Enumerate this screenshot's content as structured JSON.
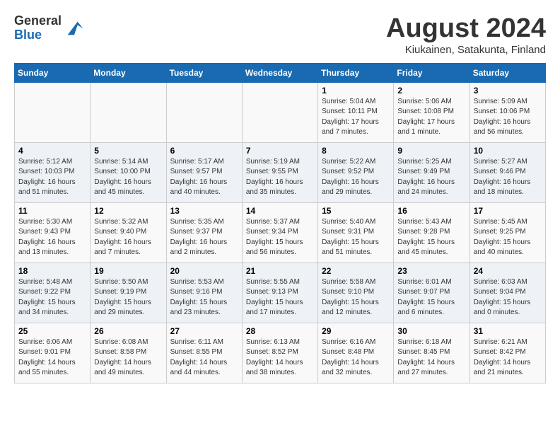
{
  "header": {
    "logo_general": "General",
    "logo_blue": "Blue",
    "month_title": "August 2024",
    "subtitle": "Kiukainen, Satakunta, Finland"
  },
  "days_of_week": [
    "Sunday",
    "Monday",
    "Tuesday",
    "Wednesday",
    "Thursday",
    "Friday",
    "Saturday"
  ],
  "weeks": [
    [
      {
        "day": "",
        "info": ""
      },
      {
        "day": "",
        "info": ""
      },
      {
        "day": "",
        "info": ""
      },
      {
        "day": "",
        "info": ""
      },
      {
        "day": "1",
        "info": "Sunrise: 5:04 AM\nSunset: 10:11 PM\nDaylight: 17 hours\nand 7 minutes."
      },
      {
        "day": "2",
        "info": "Sunrise: 5:06 AM\nSunset: 10:08 PM\nDaylight: 17 hours\nand 1 minute."
      },
      {
        "day": "3",
        "info": "Sunrise: 5:09 AM\nSunset: 10:06 PM\nDaylight: 16 hours\nand 56 minutes."
      }
    ],
    [
      {
        "day": "4",
        "info": "Sunrise: 5:12 AM\nSunset: 10:03 PM\nDaylight: 16 hours\nand 51 minutes."
      },
      {
        "day": "5",
        "info": "Sunrise: 5:14 AM\nSunset: 10:00 PM\nDaylight: 16 hours\nand 45 minutes."
      },
      {
        "day": "6",
        "info": "Sunrise: 5:17 AM\nSunset: 9:57 PM\nDaylight: 16 hours\nand 40 minutes."
      },
      {
        "day": "7",
        "info": "Sunrise: 5:19 AM\nSunset: 9:55 PM\nDaylight: 16 hours\nand 35 minutes."
      },
      {
        "day": "8",
        "info": "Sunrise: 5:22 AM\nSunset: 9:52 PM\nDaylight: 16 hours\nand 29 minutes."
      },
      {
        "day": "9",
        "info": "Sunrise: 5:25 AM\nSunset: 9:49 PM\nDaylight: 16 hours\nand 24 minutes."
      },
      {
        "day": "10",
        "info": "Sunrise: 5:27 AM\nSunset: 9:46 PM\nDaylight: 16 hours\nand 18 minutes."
      }
    ],
    [
      {
        "day": "11",
        "info": "Sunrise: 5:30 AM\nSunset: 9:43 PM\nDaylight: 16 hours\nand 13 minutes."
      },
      {
        "day": "12",
        "info": "Sunrise: 5:32 AM\nSunset: 9:40 PM\nDaylight: 16 hours\nand 7 minutes."
      },
      {
        "day": "13",
        "info": "Sunrise: 5:35 AM\nSunset: 9:37 PM\nDaylight: 16 hours\nand 2 minutes."
      },
      {
        "day": "14",
        "info": "Sunrise: 5:37 AM\nSunset: 9:34 PM\nDaylight: 15 hours\nand 56 minutes."
      },
      {
        "day": "15",
        "info": "Sunrise: 5:40 AM\nSunset: 9:31 PM\nDaylight: 15 hours\nand 51 minutes."
      },
      {
        "day": "16",
        "info": "Sunrise: 5:43 AM\nSunset: 9:28 PM\nDaylight: 15 hours\nand 45 minutes."
      },
      {
        "day": "17",
        "info": "Sunrise: 5:45 AM\nSunset: 9:25 PM\nDaylight: 15 hours\nand 40 minutes."
      }
    ],
    [
      {
        "day": "18",
        "info": "Sunrise: 5:48 AM\nSunset: 9:22 PM\nDaylight: 15 hours\nand 34 minutes."
      },
      {
        "day": "19",
        "info": "Sunrise: 5:50 AM\nSunset: 9:19 PM\nDaylight: 15 hours\nand 29 minutes."
      },
      {
        "day": "20",
        "info": "Sunrise: 5:53 AM\nSunset: 9:16 PM\nDaylight: 15 hours\nand 23 minutes."
      },
      {
        "day": "21",
        "info": "Sunrise: 5:55 AM\nSunset: 9:13 PM\nDaylight: 15 hours\nand 17 minutes."
      },
      {
        "day": "22",
        "info": "Sunrise: 5:58 AM\nSunset: 9:10 PM\nDaylight: 15 hours\nand 12 minutes."
      },
      {
        "day": "23",
        "info": "Sunrise: 6:01 AM\nSunset: 9:07 PM\nDaylight: 15 hours\nand 6 minutes."
      },
      {
        "day": "24",
        "info": "Sunrise: 6:03 AM\nSunset: 9:04 PM\nDaylight: 15 hours\nand 0 minutes."
      }
    ],
    [
      {
        "day": "25",
        "info": "Sunrise: 6:06 AM\nSunset: 9:01 PM\nDaylight: 14 hours\nand 55 minutes."
      },
      {
        "day": "26",
        "info": "Sunrise: 6:08 AM\nSunset: 8:58 PM\nDaylight: 14 hours\nand 49 minutes."
      },
      {
        "day": "27",
        "info": "Sunrise: 6:11 AM\nSunset: 8:55 PM\nDaylight: 14 hours\nand 44 minutes."
      },
      {
        "day": "28",
        "info": "Sunrise: 6:13 AM\nSunset: 8:52 PM\nDaylight: 14 hours\nand 38 minutes."
      },
      {
        "day": "29",
        "info": "Sunrise: 6:16 AM\nSunset: 8:48 PM\nDaylight: 14 hours\nand 32 minutes."
      },
      {
        "day": "30",
        "info": "Sunrise: 6:18 AM\nSunset: 8:45 PM\nDaylight: 14 hours\nand 27 minutes."
      },
      {
        "day": "31",
        "info": "Sunrise: 6:21 AM\nSunset: 8:42 PM\nDaylight: 14 hours\nand 21 minutes."
      }
    ]
  ]
}
